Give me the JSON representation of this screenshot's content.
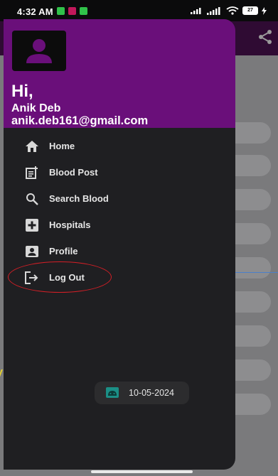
{
  "status_bar": {
    "time": "4:32 AM",
    "battery": "27",
    "notif_colors": [
      "#30c24a",
      "#c2185b",
      "#30c24a"
    ]
  },
  "drawer": {
    "header_color": "#6a0f7a",
    "greeting": "Hi,",
    "user_name": "Anik Deb",
    "user_email": "anik.deb161@gmail.com",
    "items": [
      {
        "label": "Home",
        "icon": "home-icon"
      },
      {
        "label": "Blood Post",
        "icon": "post-add-icon"
      },
      {
        "label": "Search Blood",
        "icon": "search-icon"
      },
      {
        "label": "Hospitals",
        "icon": "hospital-icon"
      },
      {
        "label": "Profile",
        "icon": "profile-icon"
      },
      {
        "label": "Log Out",
        "icon": "logout-icon"
      }
    ]
  },
  "toast": {
    "text": "10-05-2024",
    "icon": "android-icon"
  }
}
